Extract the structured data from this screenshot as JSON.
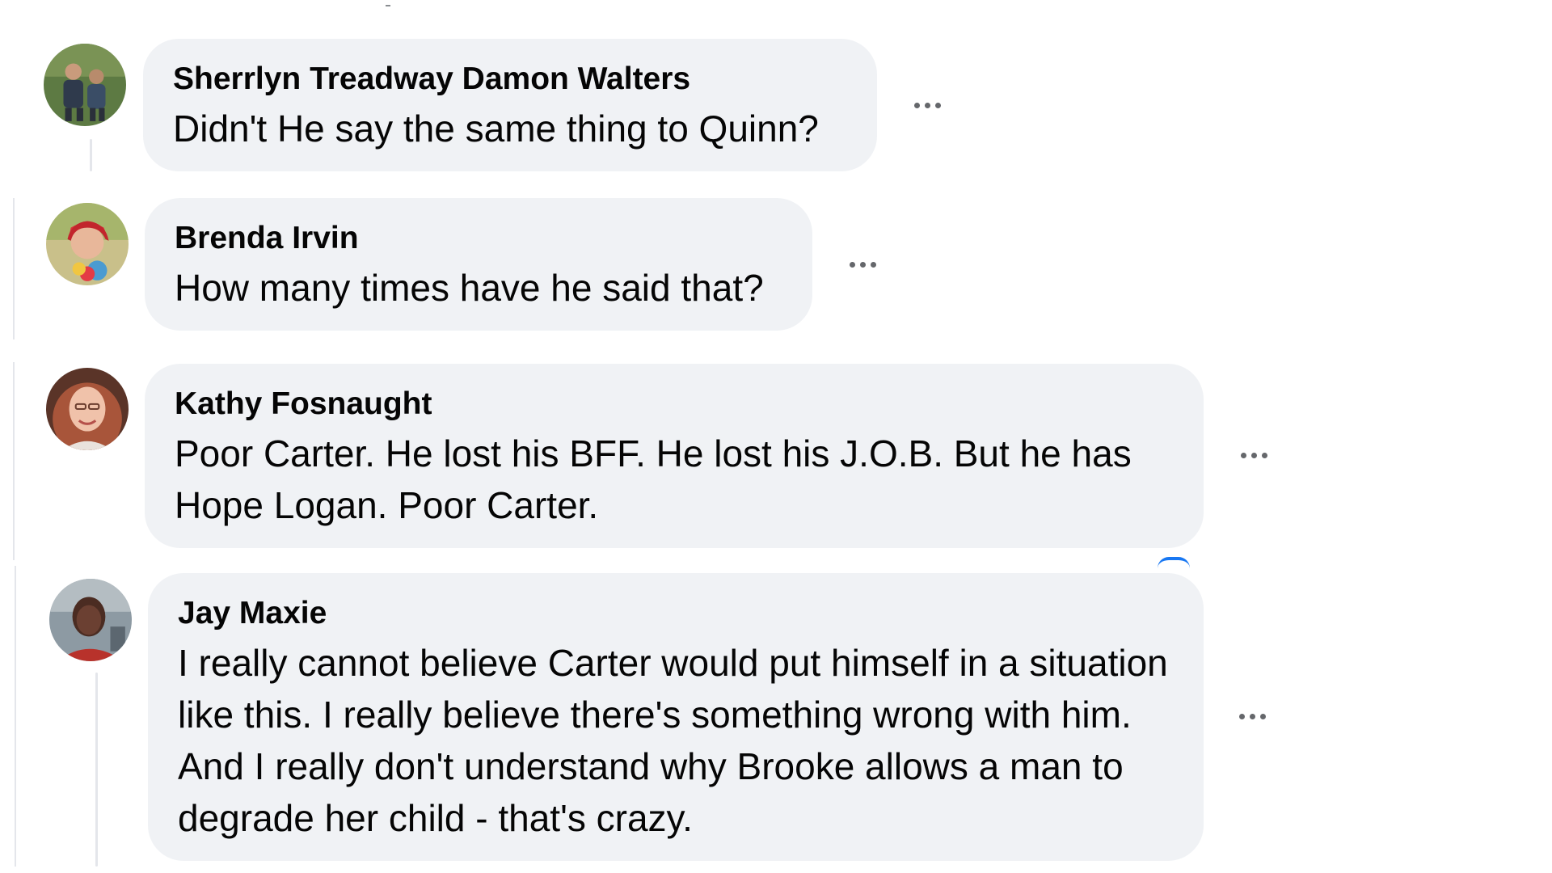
{
  "comments": [
    {
      "author": "Sherrlyn Treadway Damon Walters",
      "text": "Didn't He say the same thing to Quinn?",
      "more_icon": "more-horizontal-icon"
    },
    {
      "author": "Brenda Irvin",
      "text": "How many times have he said that?",
      "more_icon": "more-horizontal-icon"
    },
    {
      "author": "Kathy Fosnaught",
      "text": "Poor Carter. He lost his BFF. He lost his J.O.B. But he has Hope Logan. Poor Carter.",
      "more_icon": "more-horizontal-icon"
    },
    {
      "author": "Jay Maxie",
      "text": "I really cannot believe Carter would put himself in a situation like this. I really believe there's something wrong with him. And I really don't understand why Brooke allows a man to degrade her child - that's crazy.",
      "more_icon": "more-horizontal-icon"
    }
  ],
  "colors": {
    "bubble": "#f0f2f5",
    "text": "#050505",
    "icon": "#65676b",
    "thread_line": "#e4e6eb",
    "accent": "#1877f2"
  }
}
